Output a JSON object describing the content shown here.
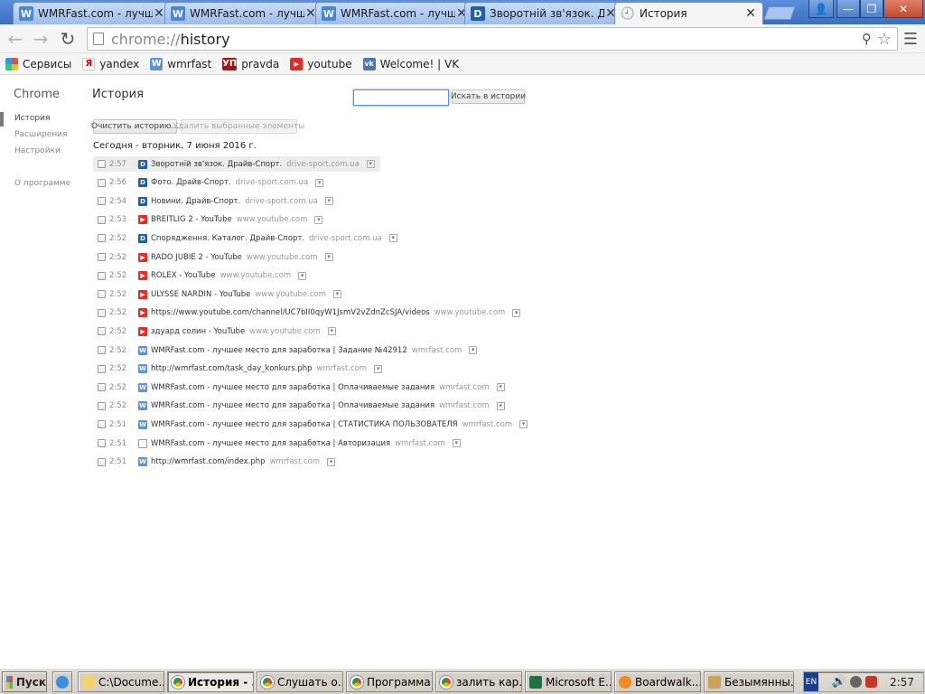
{
  "tabs": [
    {
      "title": "WMRFast.com - лучше…",
      "icon": "wmrfast-icon",
      "active": false
    },
    {
      "title": "WMRFast.com - лучше…",
      "icon": "wmrfast-icon",
      "active": false
    },
    {
      "title": "WMRFast.com - лучше…",
      "icon": "wmrfast-icon",
      "active": false
    },
    {
      "title": "Зворотній зв'язок. Др…",
      "icon": "drive-sport-icon",
      "active": false
    },
    {
      "title": "История",
      "icon": "history-icon",
      "active": true
    }
  ],
  "tab_close": "✕",
  "window_buttons": {
    "user": "👤",
    "minimize": "—",
    "restore": "❐",
    "close": "✕"
  },
  "omnibox": {
    "scheme": "chrome://",
    "path": "history"
  },
  "bookmarks": [
    {
      "label": "Сервисы",
      "icon": "apps-grid-icon"
    },
    {
      "label": "yandex",
      "icon": "yandex-icon"
    },
    {
      "label": "wmrfast",
      "icon": "wmrfast-icon"
    },
    {
      "label": "pravda",
      "icon": "pravda-icon"
    },
    {
      "label": "youtube",
      "icon": "youtube-icon"
    },
    {
      "label": "Welcome! | VK",
      "icon": "vk-icon"
    }
  ],
  "sidebar": {
    "title": "Chrome",
    "items": [
      "История",
      "Расширения",
      "Настройки",
      "О программе"
    ]
  },
  "page": {
    "title": "История",
    "search_button": "Искать в истории",
    "clear_button": "Очистить историю...",
    "remove_button": "Удалить выбранные элементы",
    "day_heading": "Сегодня - вторник, 7 июня 2016 г."
  },
  "entries": [
    {
      "time": "2:57",
      "title": "Зворотній зв'язок. Драйв-Спорт.",
      "domain": "drive-sport.com.ua",
      "icon": "drive-sport"
    },
    {
      "time": "2:56",
      "title": "Фото. Драйв-Спорт.",
      "domain": "drive-sport.com.ua",
      "icon": "drive-sport"
    },
    {
      "time": "2:54",
      "title": "Новини. Драйв-Спорт.",
      "domain": "drive-sport.com.ua",
      "icon": "drive-sport"
    },
    {
      "time": "2:53",
      "title": "BREITLIG 2 - YouTube",
      "domain": "www.youtube.com",
      "icon": "youtube"
    },
    {
      "time": "2:52",
      "title": "Спорядження. Каталог. Драйв-Спорт.",
      "domain": "drive-sport.com.ua",
      "icon": "drive-sport"
    },
    {
      "time": "2:52",
      "title": "RADO JUBIE 2 - YouTube",
      "domain": "www.youtube.com",
      "icon": "youtube"
    },
    {
      "time": "2:52",
      "title": "ROLEX - YouTube",
      "domain": "www.youtube.com",
      "icon": "youtube"
    },
    {
      "time": "2:52",
      "title": "ULYSSE NARDIN - YouTube",
      "domain": "www.youtube.com",
      "icon": "youtube"
    },
    {
      "time": "2:52",
      "title": "https://www.youtube.com/channel/UC7bII0qyW1JsmV2vZdnZcSJA/videos",
      "domain": "www.youtube.com",
      "icon": "youtube"
    },
    {
      "time": "2:52",
      "title": "эдуард солин - YouTube",
      "domain": "www.youtube.com",
      "icon": "youtube"
    },
    {
      "time": "2:52",
      "title": "WMRFast.com - лучшее место для заработка | Задание №42912",
      "domain": "wmrfast.com",
      "icon": "wmrfast"
    },
    {
      "time": "2:52",
      "title": "http://wmrfast.com/task_day_konkurs.php",
      "domain": "wmrfast.com",
      "icon": "wmrfast"
    },
    {
      "time": "2:52",
      "title": "WMRFast.com - лучшее место для заработка | Оплачиваемые задания",
      "domain": "wmrfast.com",
      "icon": "wmrfast"
    },
    {
      "time": "2:52",
      "title": "WMRFast.com - лучшее место для заработка | Оплачиваемые задания",
      "domain": "wmrfast.com",
      "icon": "wmrfast"
    },
    {
      "time": "2:51",
      "title": "WMRFast.com - лучшее место для заработка | СТАТИСТИКА ПОЛЬЗОВАТЕЛЯ",
      "domain": "wmrfast.com",
      "icon": "wmrfast"
    },
    {
      "time": "2:51",
      "title": "WMRFast.com - лучшее место для заработка | Авторизация",
      "domain": "wmrfast.com",
      "icon": "document"
    },
    {
      "time": "2:51",
      "title": "http://wmrfast.com/index.php",
      "domain": "wmrfast.com",
      "icon": "wmrfast"
    }
  ],
  "taskbar": {
    "start": "Пуск",
    "buttons": [
      {
        "label": "C:\\Docume...",
        "icon": "folder-icon"
      },
      {
        "label": "История - ...",
        "icon": "chrome-icon",
        "active": true
      },
      {
        "label": "Слушать о...",
        "icon": "chrome-icon"
      },
      {
        "label": "Программа ...",
        "icon": "chrome-icon"
      },
      {
        "label": "залить кар...",
        "icon": "chrome-icon"
      },
      {
        "label": "Microsoft E...",
        "icon": "excel-icon"
      },
      {
        "label": "Boardwalk....",
        "icon": "game-icon"
      },
      {
        "label": "Безымянны...",
        "icon": "paint-icon"
      }
    ],
    "lang": "EN",
    "clock": "2:57"
  }
}
